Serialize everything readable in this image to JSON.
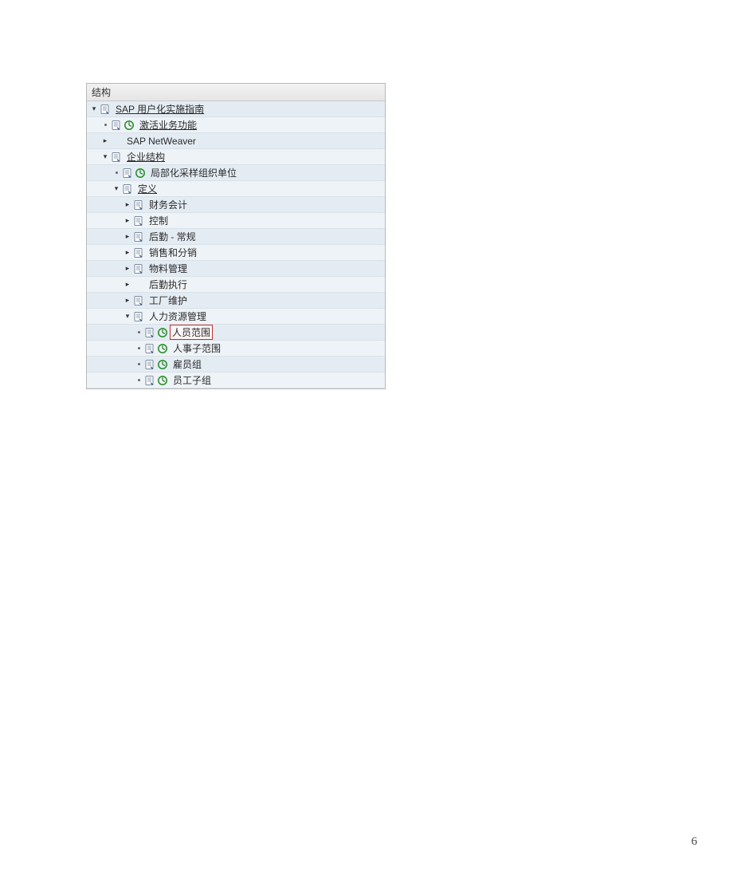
{
  "header": "结构",
  "page_number": "6",
  "toggle_open": "▾",
  "toggle_closed": "▸",
  "rows": [
    {
      "indent": 0,
      "toggle": "open",
      "dot": false,
      "doc": true,
      "activity": false,
      "label": "SAP 用户化实施指南",
      "underline": true,
      "highlight": false
    },
    {
      "indent": 14,
      "toggle": "none",
      "dot": true,
      "doc": true,
      "activity": true,
      "label": "激活业务功能",
      "underline": true,
      "highlight": false
    },
    {
      "indent": 14,
      "toggle": "closed",
      "dot": false,
      "doc": false,
      "activity": false,
      "label": "SAP NetWeaver",
      "underline": false,
      "highlight": false
    },
    {
      "indent": 14,
      "toggle": "open",
      "dot": false,
      "doc": true,
      "activity": false,
      "label": "企业结构",
      "underline": true,
      "highlight": false
    },
    {
      "indent": 28,
      "toggle": "none",
      "dot": true,
      "doc": true,
      "activity": true,
      "label": "局部化采样组织单位",
      "underline": false,
      "highlight": false
    },
    {
      "indent": 28,
      "toggle": "open",
      "dot": false,
      "doc": true,
      "activity": false,
      "label": "定义",
      "underline": true,
      "highlight": false
    },
    {
      "indent": 42,
      "toggle": "closed",
      "dot": false,
      "doc": true,
      "activity": false,
      "label": "财务会计",
      "underline": false,
      "highlight": false
    },
    {
      "indent": 42,
      "toggle": "closed",
      "dot": false,
      "doc": true,
      "activity": false,
      "label": "控制",
      "underline": false,
      "highlight": false
    },
    {
      "indent": 42,
      "toggle": "closed",
      "dot": false,
      "doc": true,
      "activity": false,
      "label": "后勤 - 常规",
      "underline": false,
      "highlight": false
    },
    {
      "indent": 42,
      "toggle": "closed",
      "dot": false,
      "doc": true,
      "activity": false,
      "label": "销售和分销",
      "underline": false,
      "highlight": false
    },
    {
      "indent": 42,
      "toggle": "closed",
      "dot": false,
      "doc": true,
      "activity": false,
      "label": "物料管理",
      "underline": false,
      "highlight": false
    },
    {
      "indent": 42,
      "toggle": "closed",
      "dot": false,
      "doc": false,
      "activity": false,
      "label": "后勤执行",
      "underline": false,
      "highlight": false
    },
    {
      "indent": 42,
      "toggle": "closed",
      "dot": false,
      "doc": true,
      "activity": false,
      "label": "工厂维护",
      "underline": false,
      "highlight": false
    },
    {
      "indent": 42,
      "toggle": "open",
      "dot": false,
      "doc": true,
      "activity": false,
      "label": "人力资源管理",
      "underline": false,
      "highlight": false
    },
    {
      "indent": 56,
      "toggle": "none",
      "dot": true,
      "doc": true,
      "activity": true,
      "label": "人员范围",
      "underline": false,
      "highlight": true
    },
    {
      "indent": 56,
      "toggle": "none",
      "dot": true,
      "doc": true,
      "activity": true,
      "label": "人事子范围",
      "underline": false,
      "highlight": false
    },
    {
      "indent": 56,
      "toggle": "none",
      "dot": true,
      "doc": true,
      "activity": true,
      "label": "雇员组",
      "underline": false,
      "highlight": false
    },
    {
      "indent": 56,
      "toggle": "none",
      "dot": true,
      "doc": true,
      "activity": true,
      "label": "员工子组",
      "underline": false,
      "highlight": false
    }
  ]
}
